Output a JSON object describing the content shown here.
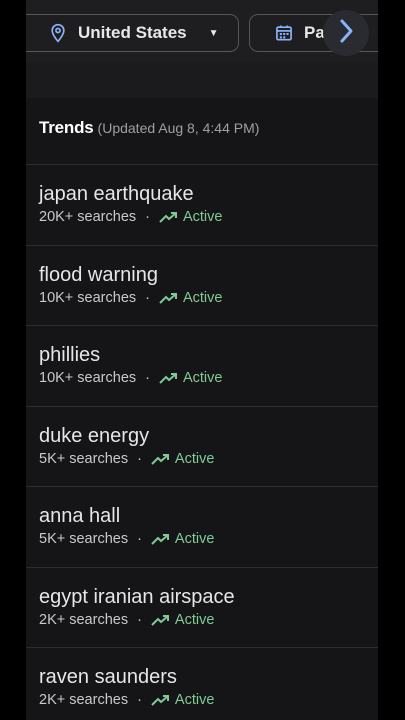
{
  "filters": {
    "location": "United States",
    "date_partial": "Pa"
  },
  "trends": {
    "title": "Trends",
    "updated": "(Updated Aug 8, 4:44 PM)"
  },
  "items": [
    {
      "name": "japan earthquake",
      "searches": "20K+ searches",
      "status": "Active"
    },
    {
      "name": "flood warning",
      "searches": "10K+ searches",
      "status": "Active"
    },
    {
      "name": "phillies",
      "searches": "10K+ searches",
      "status": "Active"
    },
    {
      "name": "duke energy",
      "searches": "5K+ searches",
      "status": "Active"
    },
    {
      "name": "anna hall",
      "searches": "5K+ searches",
      "status": "Active"
    },
    {
      "name": "egypt iranian airspace",
      "searches": "2K+ searches",
      "status": "Active"
    },
    {
      "name": "raven saunders",
      "searches": "2K+ searches",
      "status": "Active"
    }
  ],
  "colors": {
    "accent_blue": "#8ab4f8",
    "active_green": "#81c995",
    "background": "#151517"
  },
  "icons": {
    "location": "location-pin-icon",
    "date": "calendar-icon",
    "next": "chevron-right-icon",
    "trend": "trending-up-icon"
  }
}
